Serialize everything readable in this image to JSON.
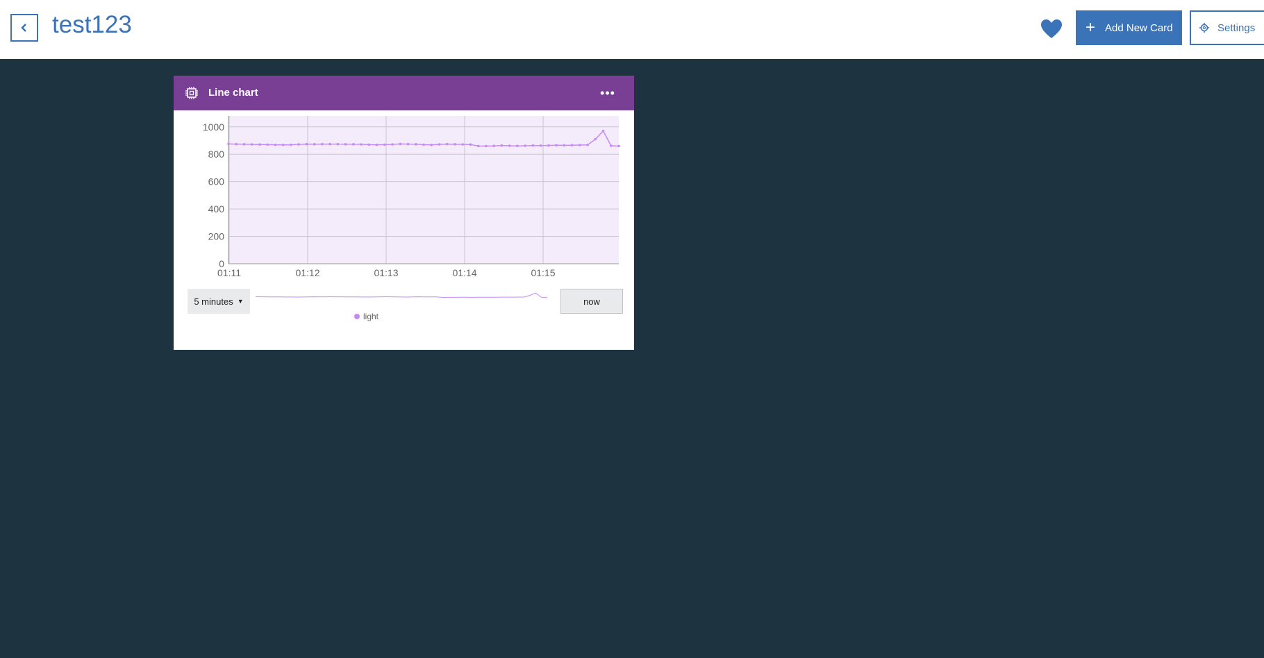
{
  "header": {
    "title": "test123",
    "add_card_label": "Add New Card",
    "settings_label": "Settings",
    "accent": "#3b73b9"
  },
  "card": {
    "title": "Line chart",
    "header_color": "#783f94",
    "menu_label": "•••",
    "range_label": "5 minutes",
    "now_label": "now"
  },
  "chart_data": {
    "type": "line",
    "title": "",
    "xlabel": "",
    "ylabel": "",
    "x_ticks": [
      "01:11",
      "01:12",
      "01:13",
      "01:14",
      "01:15"
    ],
    "y_ticks": [
      0,
      200,
      400,
      600,
      800,
      1000
    ],
    "ylim": [
      0,
      1080
    ],
    "grid": true,
    "legend_position": "bottom",
    "series": [
      {
        "name": "light",
        "color": "#c58af7",
        "values": [
          875,
          874,
          873,
          872,
          871,
          870,
          869,
          868,
          869,
          872,
          874,
          873,
          874,
          874,
          874,
          873,
          873,
          872,
          870,
          869,
          870,
          872,
          875,
          874,
          873,
          870,
          868,
          872,
          874,
          873,
          872,
          871,
          860,
          860,
          861,
          864,
          862,
          861,
          862,
          864,
          863,
          864,
          866,
          865,
          866,
          867,
          868,
          910,
          970,
          862,
          860
        ]
      }
    ]
  }
}
